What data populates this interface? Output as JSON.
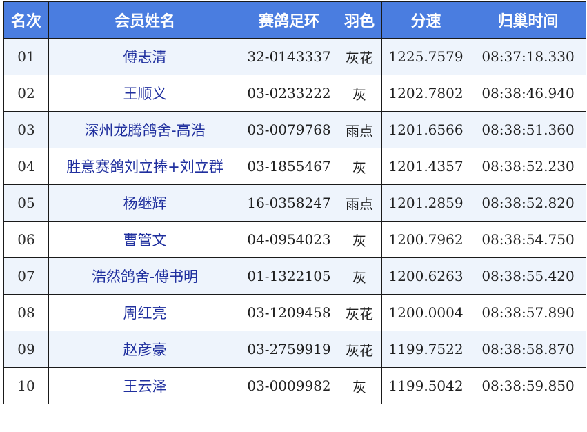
{
  "header": {
    "rank": "名次",
    "member_name": "会员姓名",
    "ring": "赛鸽足环",
    "feather_color": "羽色",
    "speed": "分速",
    "return_time": "归巢时间"
  },
  "rows": [
    {
      "rank": "01",
      "name": "傅志清",
      "ring": "32-0143337",
      "color": "灰花",
      "speed": "1225.7579",
      "time": "08:37:18.330"
    },
    {
      "rank": "02",
      "name": "王顺义",
      "ring": "03-0233222",
      "color": "灰",
      "speed": "1202.7802",
      "time": "08:38:46.940"
    },
    {
      "rank": "03",
      "name": "深州龙腾鸽舍-高浩",
      "ring": "03-0079768",
      "color": "雨点",
      "speed": "1201.6566",
      "time": "08:38:51.360"
    },
    {
      "rank": "04",
      "name": "胜意赛鸽刘立捧+刘立群",
      "ring": "03-1855467",
      "color": "灰",
      "speed": "1201.4357",
      "time": "08:38:52.230"
    },
    {
      "rank": "05",
      "name": "杨继辉",
      "ring": "16-0358247",
      "color": "雨点",
      "speed": "1201.2859",
      "time": "08:38:52.820"
    },
    {
      "rank": "06",
      "name": "曹管文",
      "ring": "04-0954023",
      "color": "灰",
      "speed": "1200.7962",
      "time": "08:38:54.750"
    },
    {
      "rank": "07",
      "name": "浩然鸽舍-傅书明",
      "ring": "01-1322105",
      "color": "灰",
      "speed": "1200.6263",
      "time": "08:38:55.420"
    },
    {
      "rank": "08",
      "name": "周红亮",
      "ring": "03-1209458",
      "color": "灰花",
      "speed": "1200.0004",
      "time": "08:38:57.890"
    },
    {
      "rank": "09",
      "name": "赵彦豪",
      "ring": "03-2759919",
      "color": "灰花",
      "speed": "1199.7522",
      "time": "08:38:58.870"
    },
    {
      "rank": "10",
      "name": "王云泽",
      "ring": "03-0009982",
      "color": "灰",
      "speed": "1199.5042",
      "time": "08:38:59.850"
    }
  ],
  "colors": {
    "header_bg": "#4a7de0",
    "header_text": "#ffffff",
    "odd_row_bg": "#eef4fc",
    "even_row_bg": "#ffffff",
    "name_text": "#1f2f9e",
    "border": "#1a1a1a"
  }
}
